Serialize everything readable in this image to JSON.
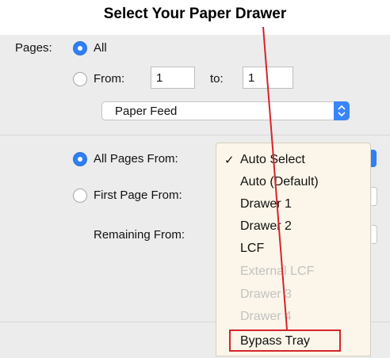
{
  "annotation": {
    "title": "Select Your Paper Drawer",
    "pointer_color": "#d6242a"
  },
  "pages": {
    "label": "Pages:",
    "all_label": "All",
    "from_label": "From:",
    "from_value": "1",
    "to_label": "to:",
    "to_value": "1"
  },
  "section_popup": {
    "selected": "Paper Feed",
    "stepper_icon": "up-down-chevron-icon"
  },
  "paper_feed": {
    "all_pages_from_label": "All Pages From:",
    "first_page_from_label": "First Page From:",
    "remaining_from_label": "Remaining From:"
  },
  "menu": {
    "check_icon": "✓",
    "items": [
      {
        "label": "Auto Select",
        "checked": true,
        "enabled": true
      },
      {
        "label": "Auto (Default)",
        "checked": false,
        "enabled": true
      },
      {
        "label": "Drawer 1",
        "checked": false,
        "enabled": true
      },
      {
        "label": "Drawer 2",
        "checked": false,
        "enabled": true
      },
      {
        "label": "LCF",
        "checked": false,
        "enabled": true
      },
      {
        "label": "External LCF",
        "checked": false,
        "enabled": false
      },
      {
        "label": "Drawer 3",
        "checked": false,
        "enabled": false
      },
      {
        "label": "Drawer 4",
        "checked": false,
        "enabled": false
      },
      {
        "label": "Bypass Tray",
        "checked": false,
        "enabled": true
      }
    ],
    "highlighted_item": "Bypass Tray"
  },
  "colors": {
    "accent": "#2f7ff6",
    "menu_background": "#fbf6e9",
    "panel_background": "#ececec"
  }
}
